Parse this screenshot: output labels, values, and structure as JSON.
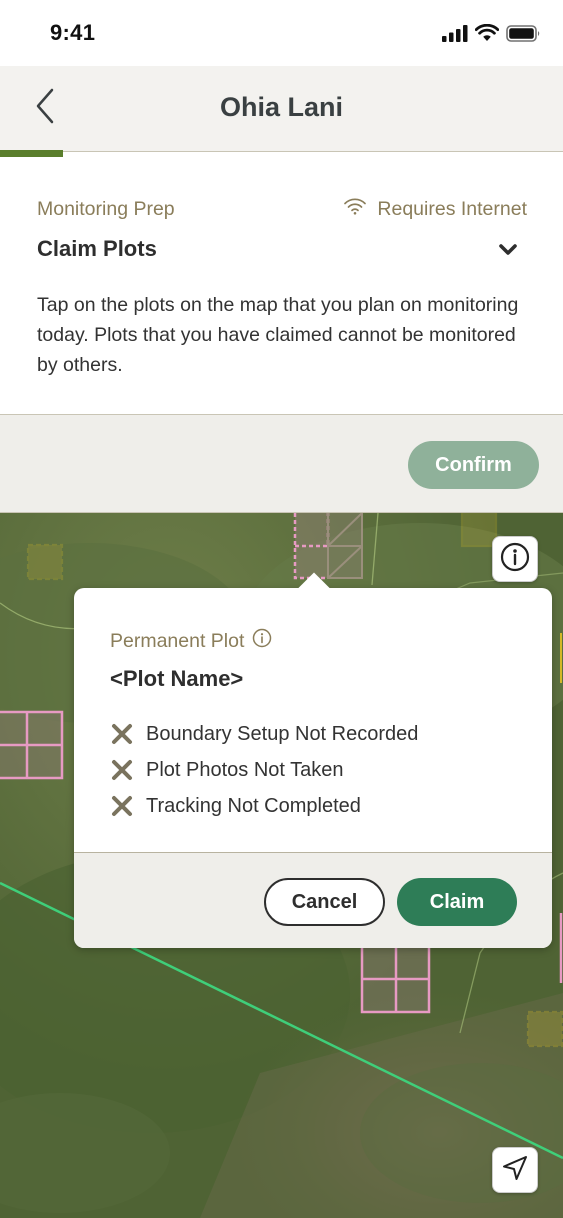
{
  "status_bar": {
    "time": "9:41"
  },
  "header": {
    "title": "Ohia Lani"
  },
  "prep": {
    "label": "Monitoring Prep",
    "internet_label": "Requires Internet",
    "title": "Claim Plots",
    "description": "Tap on the plots on the map that you plan on monitoring today. Plots that you have claimed cannot be monitored by others."
  },
  "confirm_bar": {
    "confirm_label": "Confirm"
  },
  "popup": {
    "plot_type": "Permanent Plot",
    "plot_name": "<Plot Name>",
    "checklist": [
      "Boundary Setup Not Recorded",
      "Plot Photos Not Taken",
      "Tracking Not Completed"
    ],
    "cancel_label": "Cancel",
    "claim_label": "Claim"
  },
  "colors": {
    "accent_green": "#2e7d57",
    "confirm_disabled": "#8fb19a",
    "muted_label": "#8a7d5a",
    "plot_claimed_pink": "#e79ac3",
    "plot_yellow": "#d4b828",
    "route_green": "#3fcf7a"
  }
}
